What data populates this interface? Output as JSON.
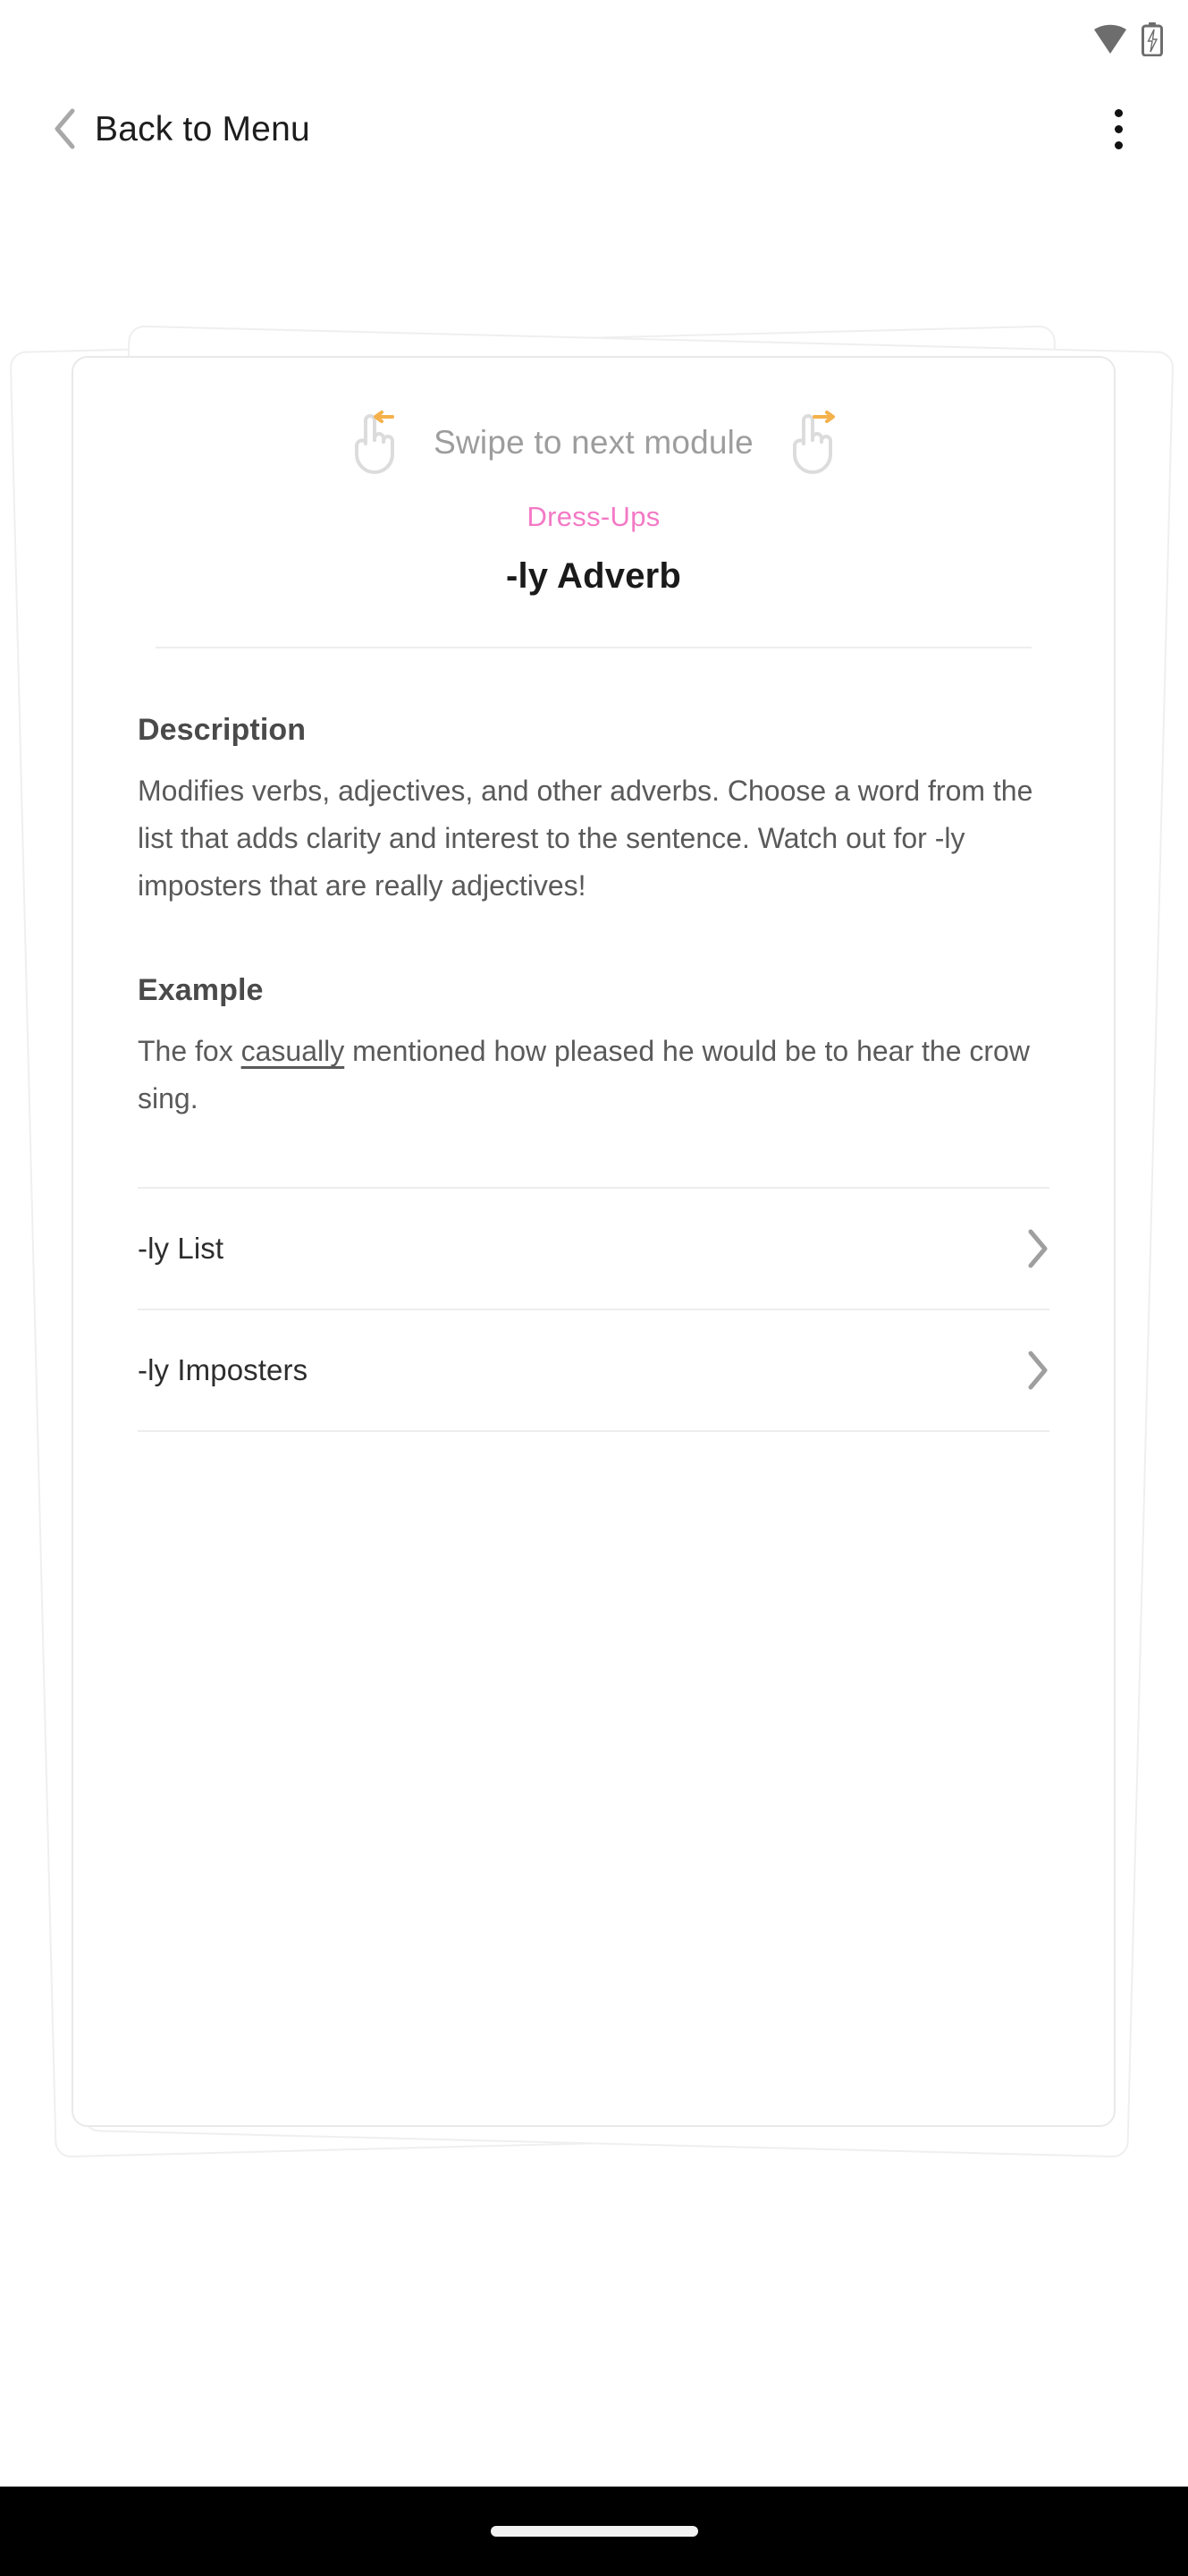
{
  "status_bar": {
    "wifi_icon": "wifi-icon",
    "battery_icon": "battery-charging-icon"
  },
  "app_bar": {
    "back_icon": "chevron-left-icon",
    "back_label": "Back to Menu",
    "overflow_icon": "overflow-menu-icon"
  },
  "card": {
    "swipe_hint": {
      "left_icon": "swipe-left-hand-icon",
      "text": "Swipe to next module",
      "right_icon": "swipe-right-hand-icon"
    },
    "category": "Dress-Ups",
    "title": "-ly Adverb",
    "description": {
      "heading": "Description",
      "text": "Modifies verbs, adjectives, and other adverbs. Choose a word from the list that adds clarity and interest to the sentence. Watch out for -ly imposters that are really adjectives!"
    },
    "example": {
      "heading": "Example",
      "text_before": "The fox ",
      "highlight": "casually",
      "text_after": " mentioned how pleased he would be to hear the crow sing."
    },
    "rows": [
      {
        "label": "-ly List",
        "chevron": "chevron-right-icon"
      },
      {
        "label": "-ly Imposters",
        "chevron": "chevron-right-icon"
      }
    ]
  },
  "nav_bar": {
    "home_indicator": "home-indicator"
  },
  "colors": {
    "accent_pink": "#f379c5",
    "arrow_orange": "#f5b14a",
    "title_dark": "#1a1a1a",
    "body_gray": "#5a5a5a",
    "hint_gray": "#9d9d9d",
    "divider": "#ededed",
    "nav_bar": "#000000"
  }
}
